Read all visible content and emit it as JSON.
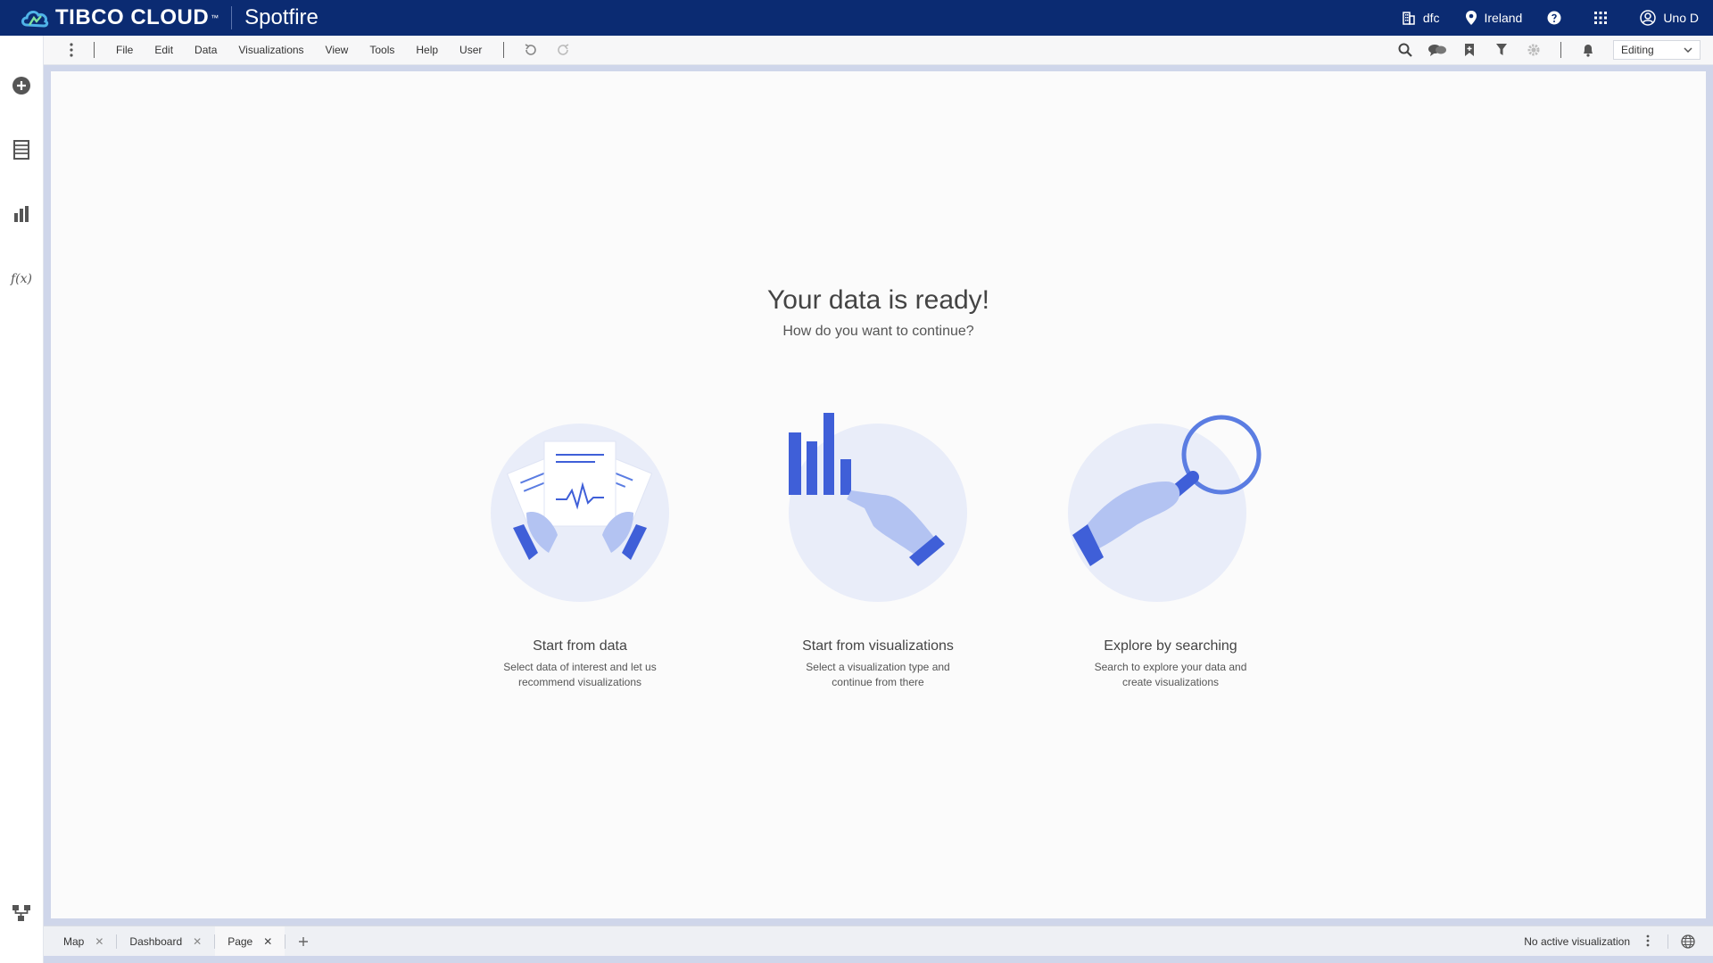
{
  "topbar": {
    "brand": "TIBCO CLOUD",
    "trademark": "™",
    "product": "Spotfire",
    "org": "dfc",
    "region": "Ireland",
    "user": "Uno D"
  },
  "menu": {
    "items": [
      "File",
      "Edit",
      "Data",
      "Visualizations",
      "View",
      "Tools",
      "Help",
      "User"
    ]
  },
  "toolbar": {
    "mode": "Editing"
  },
  "welcome": {
    "title": "Your data is ready!",
    "subtitle": "How do you want to continue?",
    "options": [
      {
        "title": "Start from data",
        "desc_line1": "Select data of interest and let us",
        "desc_line2": "recommend visualizations"
      },
      {
        "title": "Start from visualizations",
        "desc_line1": "Select a visualization type and",
        "desc_line2": "continue from there"
      },
      {
        "title": "Explore by searching",
        "desc_line1": "Search to explore your data and",
        "desc_line2": "create visualizations"
      }
    ]
  },
  "tabs": [
    {
      "label": "Map"
    },
    {
      "label": "Dashboard"
    },
    {
      "label": "Page"
    }
  ],
  "status": {
    "text": "No active visualization"
  },
  "colors": {
    "topbar": "#0b2b72",
    "accent": "#3f5fd8",
    "illustration_bg": "#e9edf9"
  }
}
